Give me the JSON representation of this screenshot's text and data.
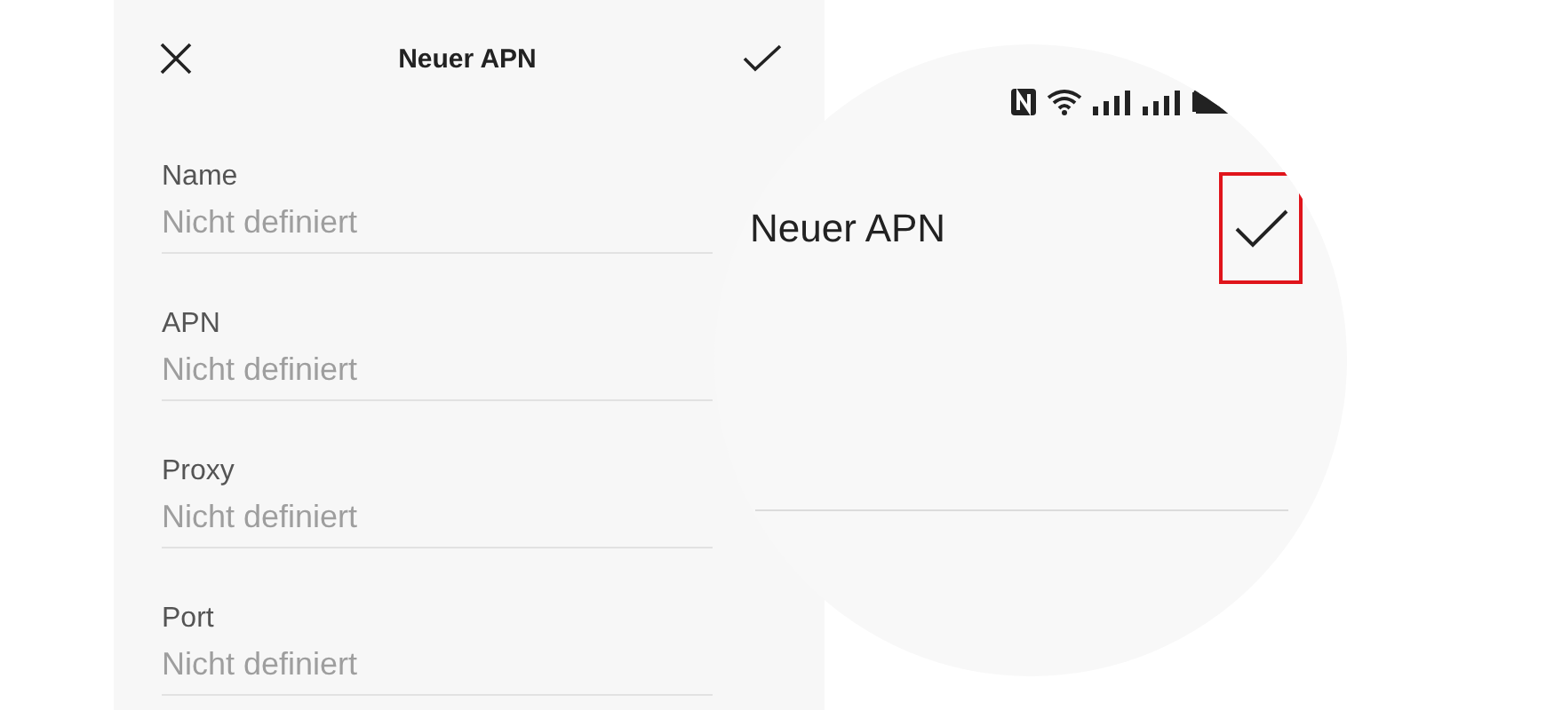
{
  "panel": {
    "title": "Neuer APN",
    "fields": [
      {
        "label": "Name",
        "placeholder": "Nicht definiert"
      },
      {
        "label": "APN",
        "placeholder": "Nicht definiert"
      },
      {
        "label": "Proxy",
        "placeholder": "Nicht definiert"
      },
      {
        "label": "Port",
        "placeholder": "Nicht definiert"
      }
    ]
  },
  "magnifier": {
    "title": "Neuer APN"
  }
}
